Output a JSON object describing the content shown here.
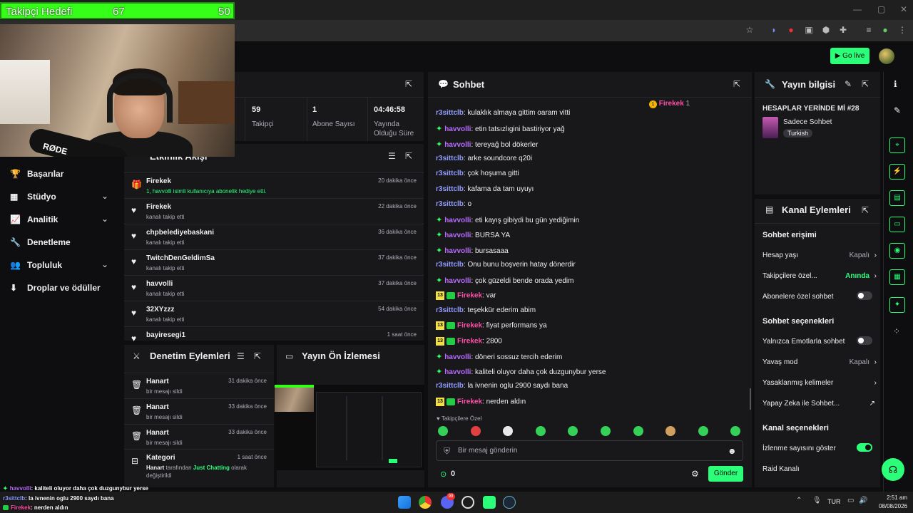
{
  "overlay": {
    "goal_label": "Takipçi Hedefi",
    "goal_current": "67",
    "goal_target": "50",
    "mic_brand": "RØDE",
    "chat_overlay": [
      {
        "name": "havvolli",
        "text": ": kaliteli oluyor daha çok duzgunybur yerse",
        "color": "#b96cff"
      },
      {
        "name": "r3sittclb",
        "text": ": la ivnenin oglu 2900 saydı bana",
        "color": "#8f9bff"
      },
      {
        "name": "Firekek",
        "text": ": nerden aldın",
        "color": "#ff4fa8"
      }
    ]
  },
  "header": {
    "go_live": "Go live"
  },
  "sidebar": {
    "items": [
      {
        "label": "Başarılar",
        "icon": "trophy-icon",
        "glyph": "🏆",
        "chevron": false
      },
      {
        "label": "Stüdyo",
        "icon": "studio-icon",
        "glyph": "▦",
        "chevron": true
      },
      {
        "label": "Analitik",
        "icon": "analytics-icon",
        "glyph": "📈",
        "chevron": true
      },
      {
        "label": "Denetleme",
        "icon": "wrench-icon",
        "glyph": "🔧",
        "chevron": false
      },
      {
        "label": "Topluluk",
        "icon": "community-icon",
        "glyph": "👥",
        "chevron": true
      },
      {
        "label": "Droplar ve ödüller",
        "icon": "drops-icon",
        "glyph": "⬇",
        "chevron": false
      }
    ]
  },
  "stats": [
    {
      "value": "59",
      "label": "Takipçi"
    },
    {
      "value": "1",
      "label": "Abone Sayısı"
    },
    {
      "value": "04:46:58",
      "label": "Yayında Olduğu Süre"
    }
  ],
  "activity": {
    "title": "Etkinlik Akışı",
    "rows": [
      {
        "name": "Firekek",
        "sub": "1, havvolli isimli kullanıcıya abonelik hediye etti.",
        "time": "20 dakika önce",
        "icon": "gift-icon"
      },
      {
        "name": "Firekek",
        "sub": "kanalı takip etti",
        "time": "22 dakika önce",
        "icon": "heart-icon"
      },
      {
        "name": "chpbelediyebaskani",
        "sub": "kanalı takip etti",
        "time": "36 dakika önce",
        "icon": "heart-icon"
      },
      {
        "name": "TwitchDenGeldimSa",
        "sub": "kanalı takip etti",
        "time": "37 dakika önce",
        "icon": "heart-icon"
      },
      {
        "name": "havvolli",
        "sub": "kanalı takip etti",
        "time": "37 dakika önce",
        "icon": "heart-icon"
      },
      {
        "name": "32XYzzz",
        "sub": "kanalı takip etti",
        "time": "54 dakika önce",
        "icon": "heart-icon"
      },
      {
        "name": "bayiresegi1",
        "sub": "",
        "time": "1 saat önce",
        "icon": "heart-icon"
      }
    ]
  },
  "moderation": {
    "title": "Denetim Eylemleri",
    "rows": [
      {
        "name": "Hanart",
        "sub": "bir mesajı sildi",
        "time": "31 dakika önce"
      },
      {
        "name": "Hanart",
        "sub": "bir mesajı sildi",
        "time": "33 dakika önce"
      },
      {
        "name": "Hanart",
        "sub": "bir mesajı sildi",
        "time": "33 dakika önce"
      }
    ],
    "category_row": {
      "name": "Kategori",
      "time": "1 saat önce",
      "actor": "Hanart",
      "mid": " tarafından ",
      "category": "Just Chatting",
      "tail": " olarak",
      "line2": "değiştirildi"
    }
  },
  "preview": {
    "title": "Yayın Ön İzlemesi"
  },
  "chat": {
    "title": "Sohbet",
    "pinned_name": "Firekek",
    "pinned_count": "1",
    "messages": [
      {
        "badge": "none",
        "name": "r3sittclb",
        "color": "#8f9bff",
        "text": ": kulaklık almaya gittim oaram vitti"
      },
      {
        "badge": "v",
        "name": "havvolli",
        "color": "#b96cff",
        "text": ": etin tatsızlıgini bastiriyor yağ"
      },
      {
        "badge": "v",
        "name": "havvolli",
        "color": "#b96cff",
        "text": ": tereyağ bol dökerler"
      },
      {
        "badge": "none",
        "name": "r3sittclb",
        "color": "#8f9bff",
        "text": ": arke soundcore q20i"
      },
      {
        "badge": "none",
        "name": "r3sittclb",
        "color": "#8f9bff",
        "text": ": çok hoşuma gitti"
      },
      {
        "badge": "none",
        "name": "r3sittclb",
        "color": "#8f9bff",
        "text": ": kafama da tam uyuyı"
      },
      {
        "badge": "none",
        "name": "r3sittclb",
        "color": "#8f9bff",
        "text": ": o"
      },
      {
        "badge": "v",
        "name": "havvolli",
        "color": "#b96cff",
        "text": ": eti kayış gibiydi bu gün yediğimin"
      },
      {
        "badge": "v",
        "name": "havvolli",
        "color": "#b96cff",
        "text": ": BURSA YA"
      },
      {
        "badge": "v",
        "name": "havvolli",
        "color": "#b96cff",
        "text": ": bursasaaa"
      },
      {
        "badge": "none",
        "name": "r3sittclb",
        "color": "#8f9bff",
        "text": ": Onu bunu boşverin hatay dönerdir"
      },
      {
        "badge": "v",
        "name": "havvolli",
        "color": "#b96cff",
        "text": ": çok güzeldi bende orada yedim"
      },
      {
        "badge": "n",
        "name": "Firekek",
        "color": "#ff4fa8",
        "text": ": var"
      },
      {
        "badge": "none",
        "name": "r3sittclb",
        "color": "#8f9bff",
        "text": ": teşekkür ederim abim"
      },
      {
        "badge": "n",
        "name": "Firekek",
        "color": "#ff4fa8",
        "text": ": fiyat performans ya"
      },
      {
        "badge": "n",
        "name": "Firekek",
        "color": "#ff4fa8",
        "text": ": 2800"
      },
      {
        "badge": "v",
        "name": "havvolli",
        "color": "#b96cff",
        "text": ": döneri sossuz tercih ederim"
      },
      {
        "badge": "v",
        "name": "havvolli",
        "color": "#b96cff",
        "text": ": kaliteli oluyor daha çok duzgunybur yerse"
      },
      {
        "badge": "none",
        "name": "r3sittclb",
        "color": "#8f9bff",
        "text": ": la ivnenin oglu 2900 saydı bana"
      },
      {
        "badge": "n",
        "name": "Firekek",
        "color": "#ff4fa8",
        "text": ": nerden aldın"
      }
    ],
    "sub_badge_num": "13",
    "follower_only_label": "Takipçilere Özel",
    "input_placeholder": "Bir mesaj gönderin",
    "points": "0",
    "send_label": "Gönder"
  },
  "stream_info": {
    "title": "Yayın bilgisi",
    "stream_title": "HESAPLAR YERİNDE Mİ #28",
    "category": "Sadece Sohbet",
    "tag": "Turkish"
  },
  "channel_actions": {
    "title": "Kanal Eylemleri",
    "chat_access": "Sohbet erişimi",
    "account_age": "Hesap yaşı",
    "account_age_val": "Kapalı",
    "followers_only": "Takipçilere özel...",
    "followers_only_val": "Anında",
    "subs_only": "Abonelere özel sohbet",
    "chat_options": "Sohbet seçenekleri",
    "emote_only": "Yalnızca Emotlarla sohbet",
    "slow_mode": "Yavaş mod",
    "slow_mode_val": "Kapalı",
    "banned_words": "Yasaklanmış kelimeler",
    "ai_chat": "Yapay Zeka ile Sohbet...",
    "channel_options": "Kanal seçenekleri",
    "show_viewers": "İzlenme sayısını göster",
    "raid": "Raid Kanalı"
  },
  "taskbar": {
    "lang": "TUR",
    "time": "2:51 am",
    "date": "08/08/2026",
    "notif_count": "99"
  },
  "colors": {
    "accent": "#2bff7a",
    "goal": "#35ff19"
  }
}
